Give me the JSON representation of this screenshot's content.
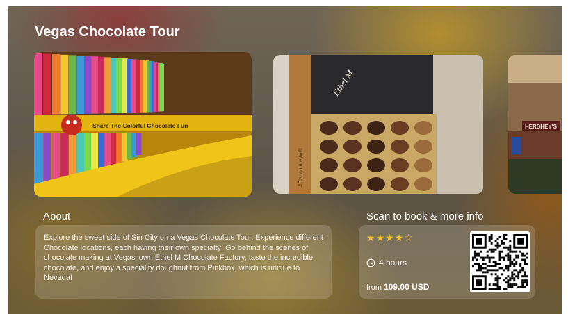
{
  "tour": {
    "title": "Vegas Chocolate Tour"
  },
  "gallery": {
    "photo_1": {
      "sign_text": "Share The Colorful Chocolate Fun"
    },
    "photo_2": {
      "brand_text": "Ethel M",
      "side_text": "#ChocolateWall"
    },
    "photo_3": {
      "sign_text": "HERSHEY'S"
    }
  },
  "about": {
    "heading": "About",
    "description": "Explore the sweet side of Sin City on a Vegas Chocolate Tour. Experience different Chocolate locations, each having their own specialty! Go behind the scenes of chocolate making at Vegas' own Ethel M Chocolate Factory, taste the incredible chocolate, and enjoy a speciality doughnut from Pinkbox, which is unique to Nevada!"
  },
  "booking": {
    "heading": "Scan to book & more info",
    "rating": {
      "value": 4,
      "max": 5
    },
    "duration": "4 hours",
    "price_prefix": "from",
    "price_amount": "109.00 USD",
    "icons": {
      "duration": "clock-icon",
      "qr": "qr-code"
    }
  },
  "colors": {
    "star": "#f2c02e",
    "text": "#ffffff",
    "card": "rgba(255,255,255,0.16)"
  }
}
